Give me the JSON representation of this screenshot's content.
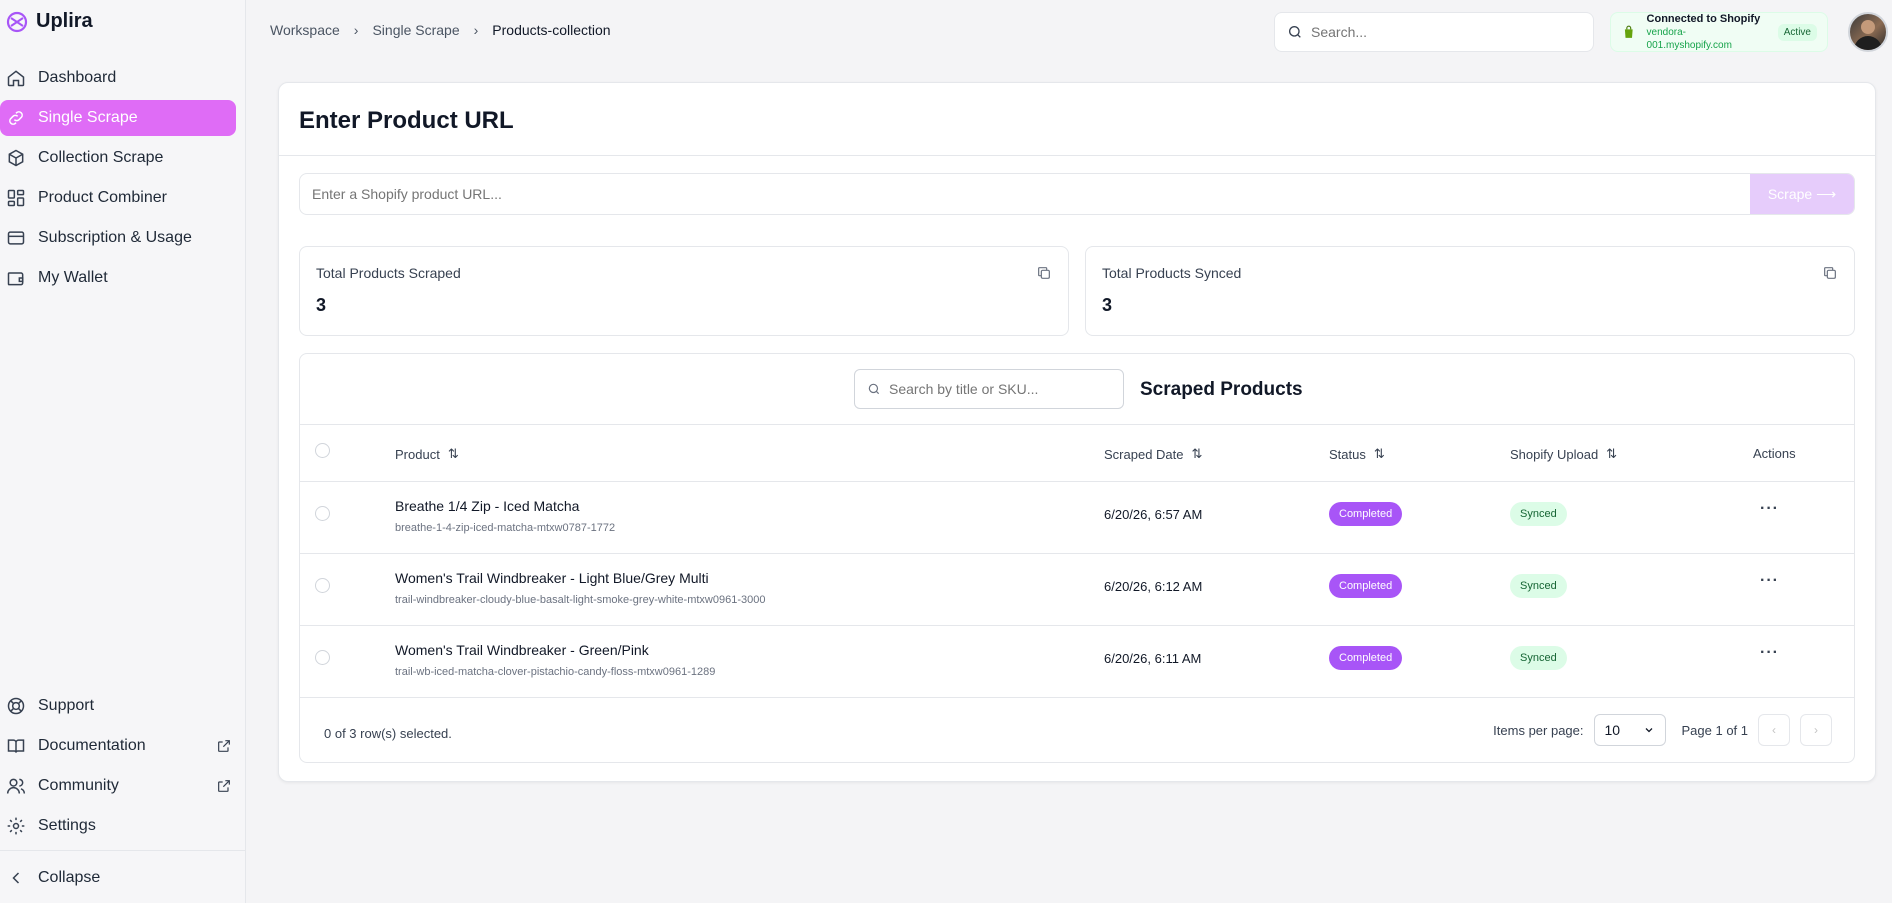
{
  "app": {
    "name": "Uplira"
  },
  "sidebar": {
    "items": [
      {
        "label": "Dashboard",
        "icon": "home-icon"
      },
      {
        "label": "Single Scrape",
        "icon": "link-icon"
      },
      {
        "label": "Collection Scrape",
        "icon": "box-icon"
      },
      {
        "label": "Product Combiner",
        "icon": "combine-icon"
      },
      {
        "label": "Subscription & Usage",
        "icon": "credit-card-icon"
      },
      {
        "label": "My Wallet",
        "icon": "wallet-icon"
      }
    ],
    "bottom_items": [
      {
        "label": "Support",
        "icon": "lifebuoy-icon"
      },
      {
        "label": "Documentation",
        "icon": "book-icon"
      },
      {
        "label": "Community",
        "icon": "users-icon"
      },
      {
        "label": "Settings",
        "icon": "gear-icon"
      }
    ],
    "collapse_label": "Collapse",
    "active_color": "#df6cf6"
  },
  "header": {
    "breadcrumb": [
      "Workspace",
      "Single Scrape",
      "Products-collection"
    ],
    "search_placeholder": "Search...",
    "shopify": {
      "title": "Connected to Shopify",
      "store": "vendora-001.myshopify.com",
      "status": "Active"
    }
  },
  "main": {
    "title": "Enter Product URL",
    "url_placeholder": "Enter a Shopify product URL...",
    "scrape_label": "Scrape ⟶",
    "stats": [
      {
        "label": "Total Products Scraped",
        "value": "3"
      },
      {
        "label": "Total Products Synced",
        "value": "3"
      }
    ]
  },
  "table": {
    "title": "Scraped Products",
    "search_placeholder": "Search by title or SKU...",
    "columns": [
      "Product",
      "Scraped Date",
      "Status",
      "Shopify Upload",
      "Actions"
    ],
    "rows": [
      {
        "title": "Breathe 1/4 Zip - Iced Matcha",
        "sku": "breathe-1-4-zip-iced-matcha-mtxw0787-1772",
        "date": "6/20/26, 6:57 AM",
        "status": "Completed",
        "upload": "Synced"
      },
      {
        "title": "Women's Trail Windbreaker - Light Blue/Grey Multi",
        "sku": "trail-windbreaker-cloudy-blue-basalt-light-smoke-grey-white-mtxw0961-3000",
        "date": "6/20/26, 6:12 AM",
        "status": "Completed",
        "upload": "Synced"
      },
      {
        "title": "Women's Trail Windbreaker - Green/Pink",
        "sku": "trail-wb-iced-matcha-clover-pistachio-candy-floss-mtxw0961-1289",
        "date": "6/20/26, 6:11 AM",
        "status": "Completed",
        "upload": "Synced"
      }
    ],
    "footer": {
      "selected": "0 of 3 row(s) selected.",
      "items_per_page_label": "Items per page:",
      "items_per_page": "10",
      "page_info": "Page 1 of 1"
    },
    "status_color": "#a855f7",
    "synced_color": "#dcfce7"
  }
}
